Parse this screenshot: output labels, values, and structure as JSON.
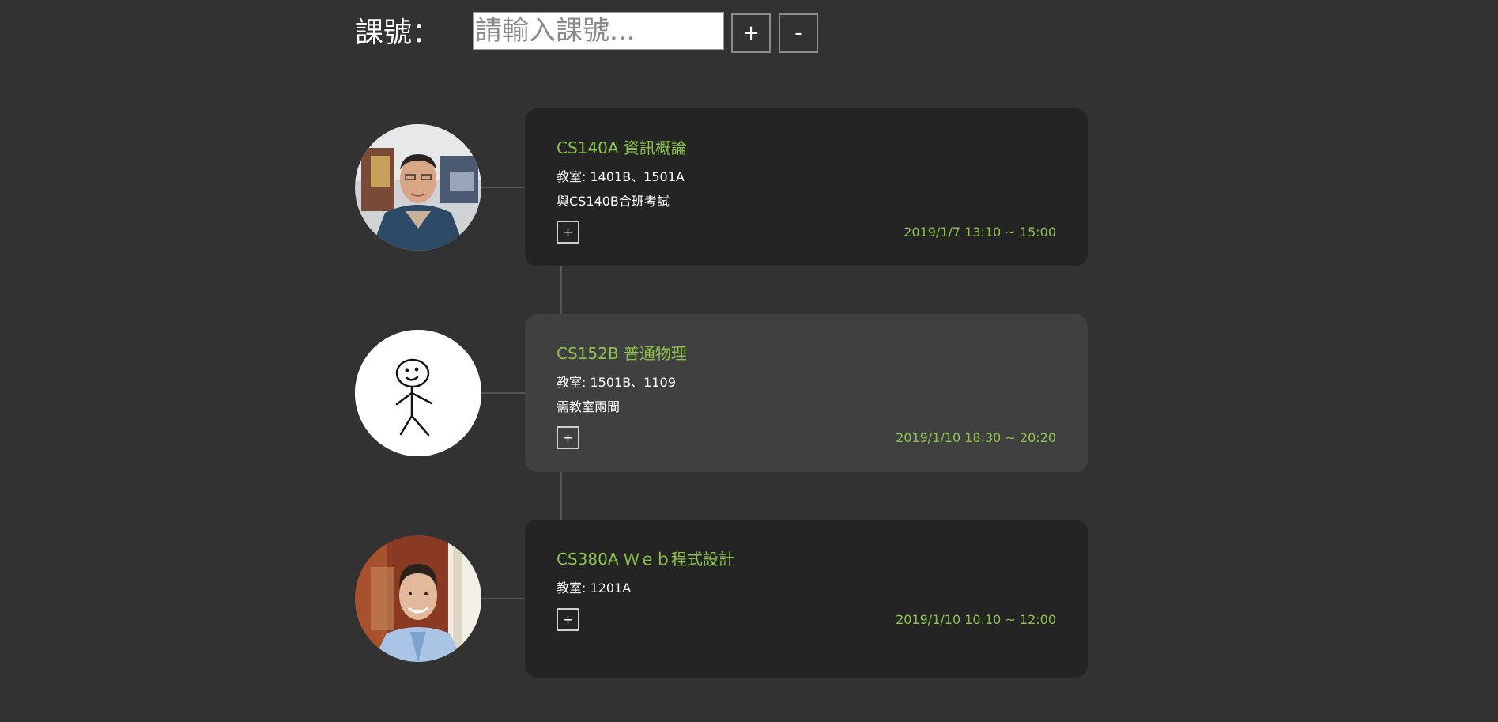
{
  "header": {
    "label": "課號：",
    "input_placeholder": "請輸入課號...",
    "add_label": "+",
    "remove_label": "-"
  },
  "courses": [
    {
      "code": "CS140A",
      "name": "資訊概論",
      "room": "教室: 1401B、1501A",
      "note": "與CS140B合班考試",
      "expand_label": "+",
      "time": "2019/1/7 13:10 ~ 15:00",
      "avatar_icon": "teacher-photo"
    },
    {
      "code": "CS152B",
      "name": "普通物理",
      "room": "教室: 1501B、1109",
      "note": "需教室兩間",
      "expand_label": "+",
      "time": "2019/1/10 18:30 ~ 20:20",
      "avatar_icon": "stick-figure-icon"
    },
    {
      "code": "CS380A",
      "name": "Ｗｅｂ程式設計",
      "room": "教室: 1201A",
      "note": "",
      "expand_label": "+",
      "time": "2019/1/10 10:10 ~ 12:00",
      "avatar_icon": "teacher-photo"
    }
  ],
  "colors": {
    "background": "#323232",
    "card": "#242424",
    "card_hover": "#404040",
    "accent": "#8bc34a",
    "line": "#555555"
  }
}
